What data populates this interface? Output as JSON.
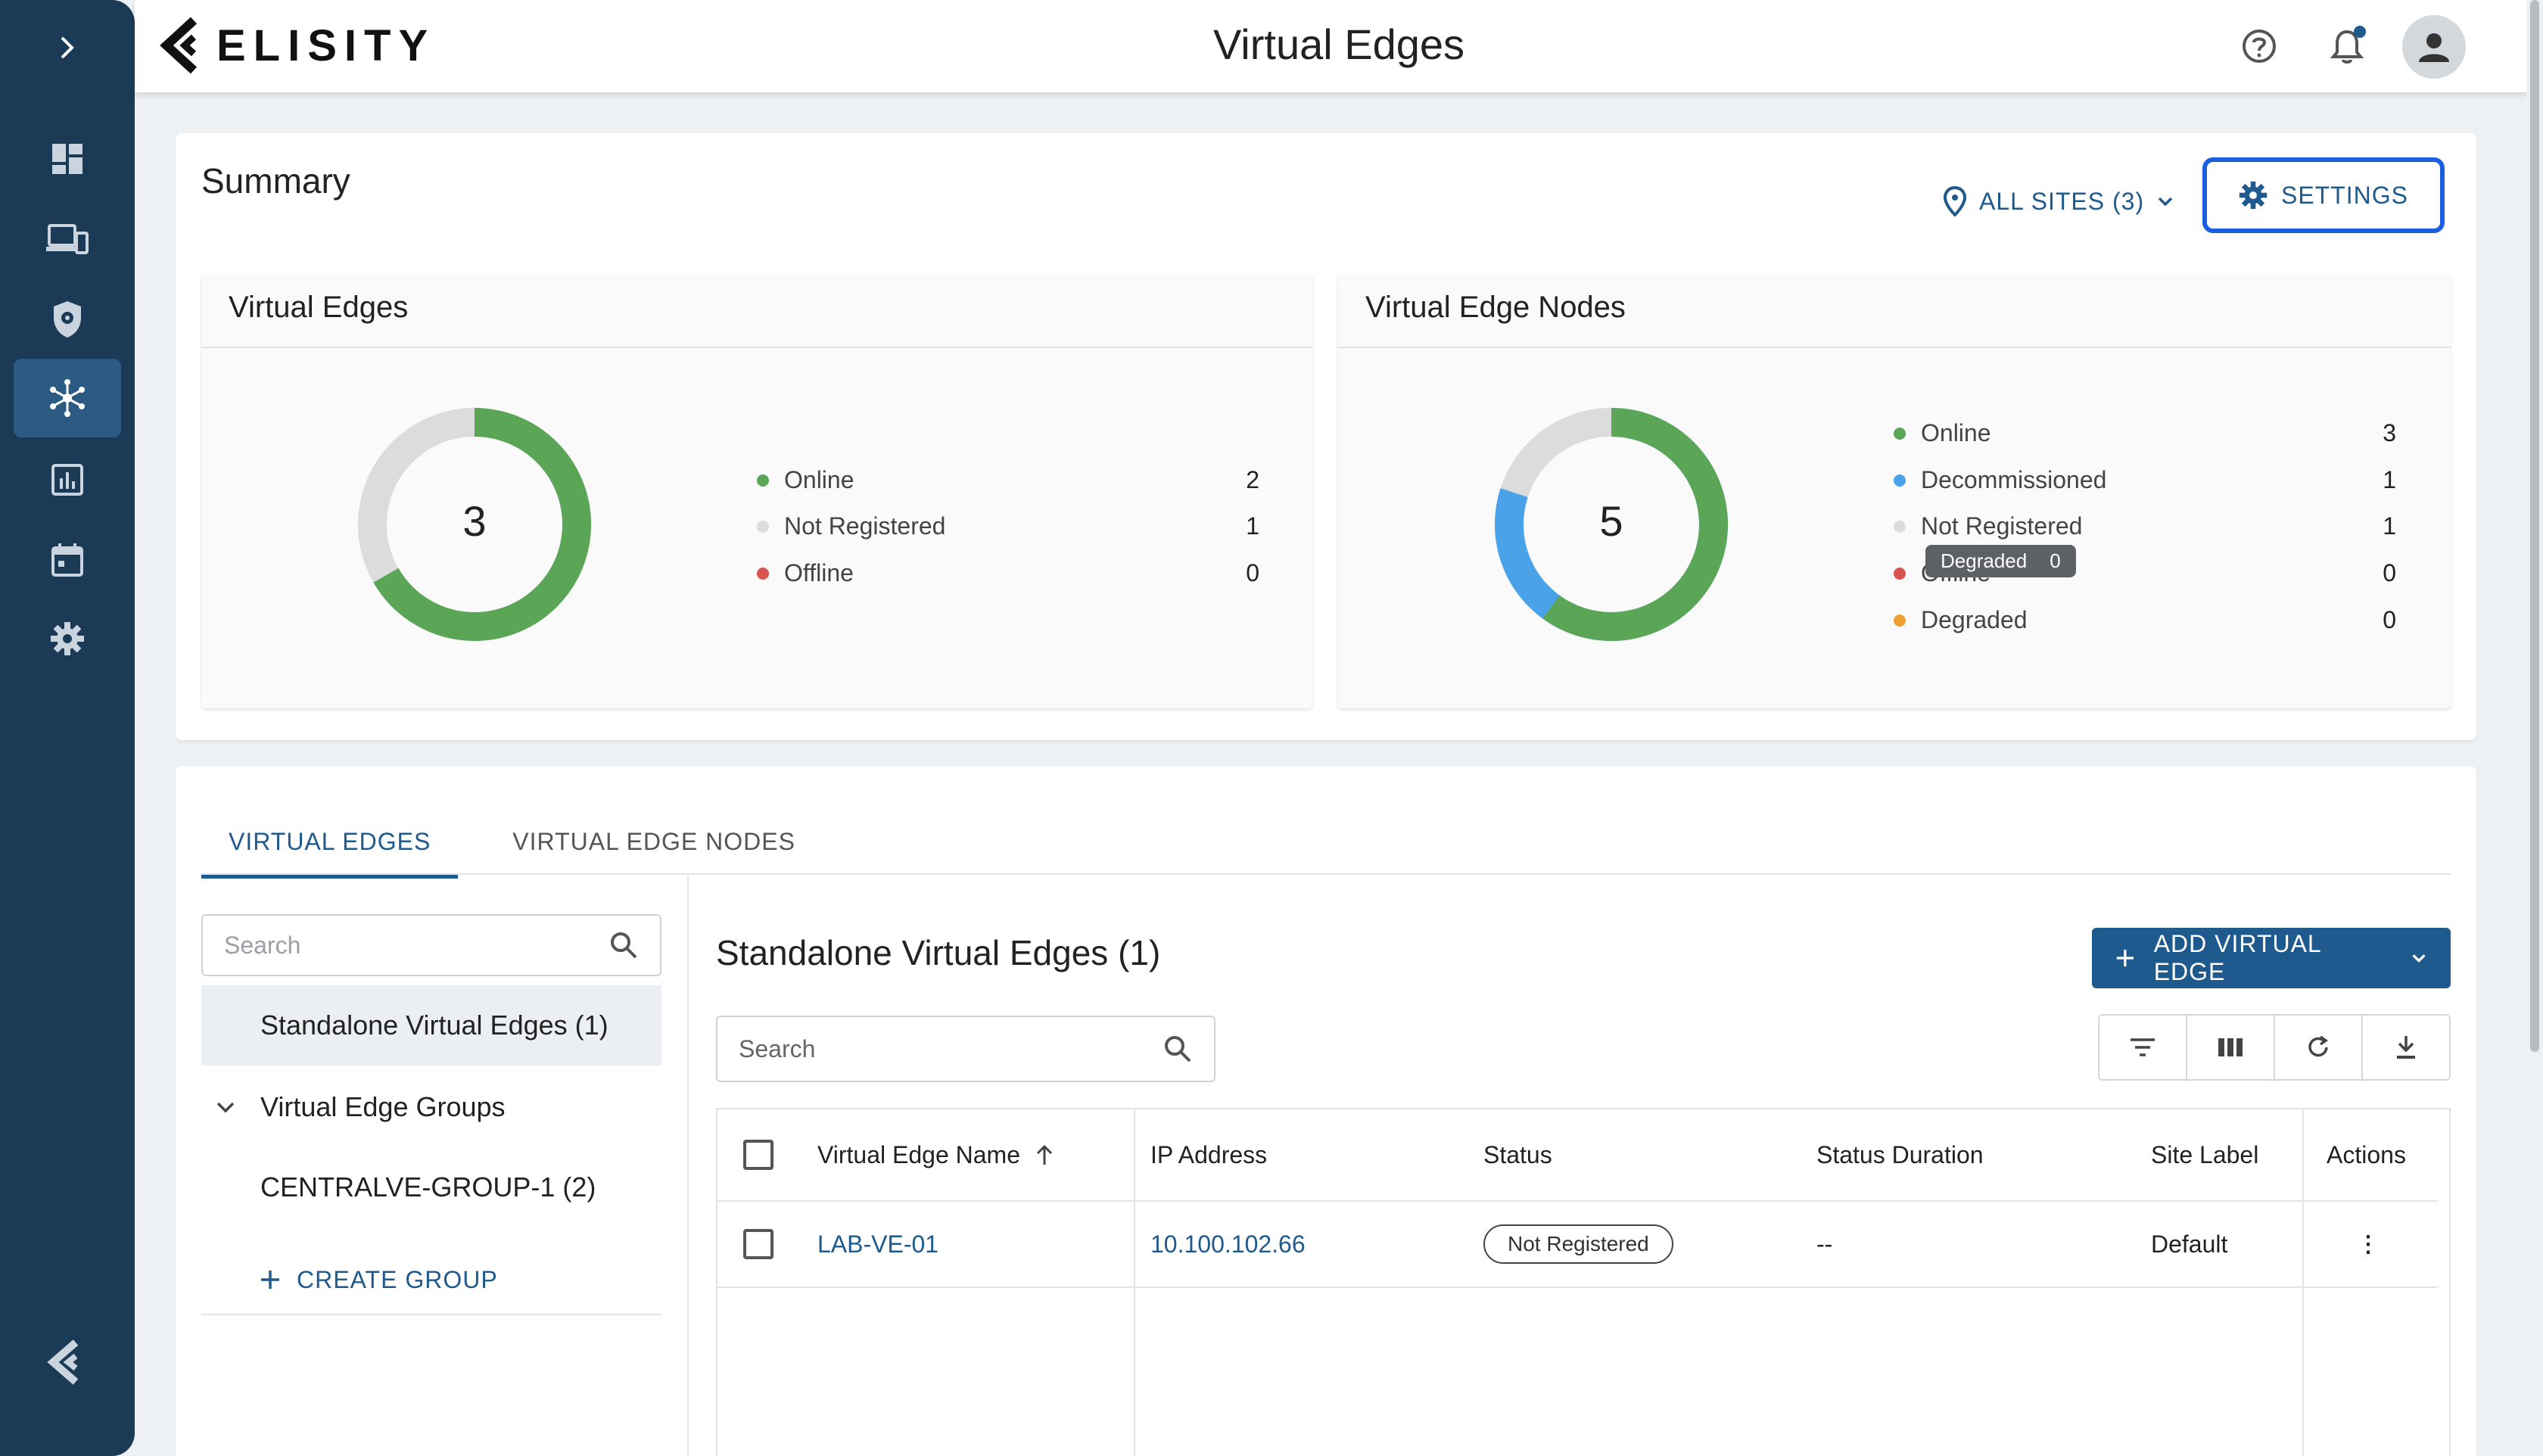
{
  "rail": {
    "items": [
      "dashboard",
      "devices",
      "policy",
      "virtual-edges",
      "analytics",
      "calendar",
      "settings"
    ],
    "active": "virtual-edges"
  },
  "header": {
    "brand": "ELISITY",
    "title": "Virtual Edges"
  },
  "summary": {
    "title": "Summary",
    "site_selector": "ALL SITES (3)",
    "settings_label": "SETTINGS",
    "virtual_edges": {
      "title": "Virtual Edges",
      "total": "3",
      "legend": [
        {
          "label": "Online",
          "count": "2",
          "color": "#5aa556"
        },
        {
          "label": "Not Registered",
          "count": "1",
          "color": "#dcdcdc"
        },
        {
          "label": "Offline",
          "count": "0",
          "color": "#d9534f"
        }
      ]
    },
    "virtual_edge_nodes": {
      "title": "Virtual Edge Nodes",
      "total": "5",
      "legend": [
        {
          "label": "Online",
          "count": "3",
          "color": "#5aa556"
        },
        {
          "label": "Decommissioned",
          "count": "1",
          "color": "#4aa3e8"
        },
        {
          "label": "Not Registered",
          "count": "1",
          "color": "#dcdcdc"
        },
        {
          "label": "Offline",
          "count": "0",
          "color": "#d9534f"
        },
        {
          "label": "Degraded",
          "count": "0",
          "color": "#f0a033"
        }
      ],
      "tooltip": {
        "label": "Degraded",
        "value": "0"
      }
    }
  },
  "tabs": [
    {
      "label": "VIRTUAL EDGES",
      "active": true
    },
    {
      "label": "VIRTUAL EDGE NODES",
      "active": false
    }
  ],
  "left_panel": {
    "search_placeholder": "Search",
    "standalone": "Standalone Virtual Edges (1)",
    "groups_label": "Virtual Edge Groups",
    "group_item": "CENTRALVE-GROUP-1 (2)",
    "create_group": "CREATE GROUP"
  },
  "main_panel": {
    "title": "Standalone Virtual Edges (1)",
    "add_button": "ADD VIRTUAL EDGE",
    "search_placeholder": "Search",
    "columns": [
      "Virtual Edge Name",
      "IP Address",
      "Status",
      "Status Duration",
      "Site Label",
      "Actions"
    ],
    "rows": [
      {
        "name": "LAB-VE-01",
        "ip": "10.100.102.66",
        "status": "Not Registered",
        "duration": "--",
        "site": "Default",
        "actions": "⋮"
      }
    ]
  }
}
